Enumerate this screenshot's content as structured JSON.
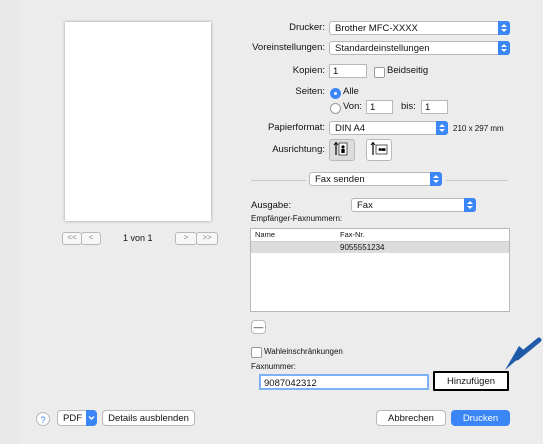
{
  "preview": {
    "pager": {
      "first": "<<",
      "prev": "<",
      "text": "1 von 1",
      "next": ">",
      "last": ">>"
    }
  },
  "printer": {
    "label": "Drucker:",
    "value": "Brother MFC-XXXX"
  },
  "presets": {
    "label": "Voreinstellungen:",
    "value": "Standardeinstellungen"
  },
  "copies": {
    "label": "Kopien:",
    "value": "1",
    "duplex_label": "Beidseitig"
  },
  "pages": {
    "label": "Seiten:",
    "all": "Alle",
    "from": "Von:",
    "from_value": "1",
    "to": "bis:",
    "to_value": "1"
  },
  "paper": {
    "label": "Papierformat:",
    "value": "DIN A4",
    "size": "210 x 297 mm"
  },
  "orientation": {
    "label": "Ausrichtung:"
  },
  "section": {
    "value": "Fax senden"
  },
  "output": {
    "label": "Ausgabe:",
    "value": "Fax"
  },
  "recipients": {
    "label": "Empfänger-Faxnummern:",
    "col_name": "Name",
    "col_fax": "Fax-Nr.",
    "rows": [
      {
        "name": "",
        "fax": "9055551234"
      }
    ],
    "remove": "—"
  },
  "dial_restrictions": "Wahleinschränkungen",
  "fax_number": {
    "label": "Faxnummer:",
    "value": "9087042312",
    "add": "Hinzufügen"
  },
  "footer": {
    "help": "?",
    "pdf": "PDF",
    "details": "Details ausblenden",
    "cancel": "Abbrechen",
    "print": "Drucken"
  },
  "colors": {
    "accent": "#3b86f7",
    "pointer": "#1f5ba8"
  }
}
